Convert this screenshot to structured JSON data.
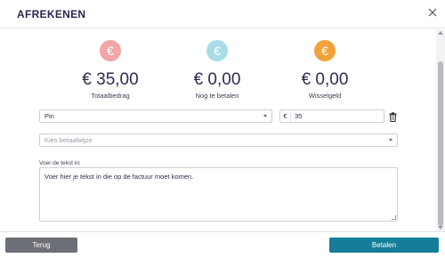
{
  "header": {
    "title": "AFREKENEN",
    "close_icon": "close-icon"
  },
  "summary": [
    {
      "icon": "euro-icon",
      "icon_glyph": "€",
      "color": "#f2a6a6",
      "amount": "€ 35,00",
      "label": "Totaalbedrag"
    },
    {
      "icon": "euro-icon",
      "icon_glyph": "€",
      "color": "#a8dde6",
      "amount": "€ 0,00",
      "label": "Nog te betalen"
    },
    {
      "icon": "euro-icon",
      "icon_glyph": "€",
      "color": "#f0a33a",
      "amount": "€ 0,00",
      "label": "Wisselgeld"
    }
  ],
  "payment_line": {
    "method": "Pin",
    "currency": "€",
    "amount": "35",
    "delete_icon": "trash-icon"
  },
  "new_payment": {
    "placeholder": "Kies betaalwijze"
  },
  "invoice_text": {
    "label": "Voer de tekst in:",
    "value": "Voer hier je tekst in die op de factuur moet komen."
  },
  "footer": {
    "back_label": "Terug",
    "pay_label": "Betalen"
  },
  "colors": {
    "primary": "#147e9a",
    "secondary": "#6c6f76",
    "text": "#2e2a4f"
  }
}
